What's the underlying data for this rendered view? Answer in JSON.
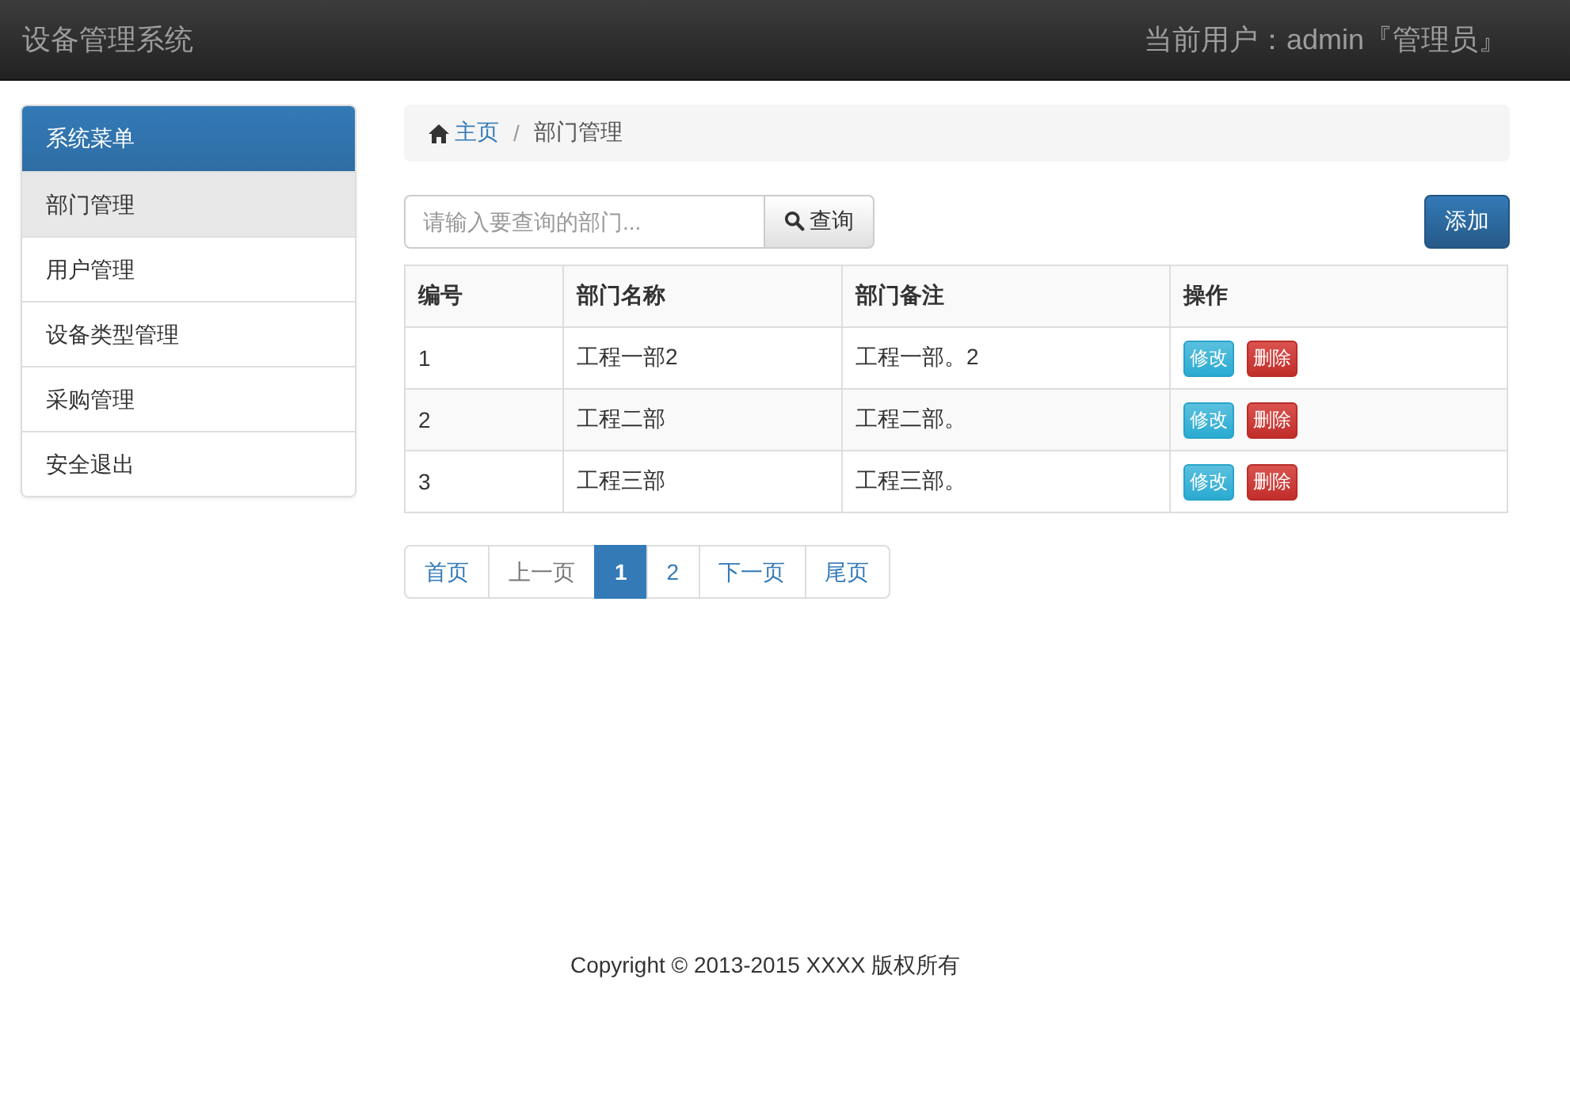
{
  "navbar": {
    "brand": "设备管理系统",
    "user_info": "当前用户：admin『管理员』"
  },
  "sidebar": {
    "title": "系统菜单",
    "items": [
      {
        "label": "部门管理",
        "selected": true
      },
      {
        "label": "用户管理",
        "selected": false
      },
      {
        "label": "设备类型管理",
        "selected": false
      },
      {
        "label": "采购管理",
        "selected": false
      },
      {
        "label": "安全退出",
        "selected": false
      }
    ]
  },
  "breadcrumb": [
    {
      "label": "主页",
      "kind": "home"
    },
    {
      "label": "/",
      "kind": "separator"
    },
    {
      "label": "部门管理",
      "kind": "current"
    }
  ],
  "search": {
    "placeholder": "请输入要查询的部门...",
    "button": "查询"
  },
  "add_button": "添加",
  "table": {
    "columns": [
      "编号",
      "部门名称",
      "部门备注",
      "操作"
    ],
    "rows": [
      {
        "cells": [
          "1",
          "工程一部2",
          "工程一部。2"
        ],
        "actions": [
          "修改",
          "删除"
        ]
      },
      {
        "cells": [
          "2",
          "工程二部",
          "工程二部。"
        ],
        "actions": [
          "修改",
          "删除"
        ]
      },
      {
        "cells": [
          "3",
          "工程三部",
          "工程三部。"
        ],
        "actions": [
          "修改",
          "删除"
        ]
      }
    ]
  },
  "pagination": [
    {
      "label": "首页",
      "selected": false,
      "disabled": false
    },
    {
      "label": "上一页",
      "selected": false,
      "disabled": true
    },
    {
      "label": "1",
      "selected": true,
      "disabled": false
    },
    {
      "label": "2",
      "selected": false,
      "disabled": false
    },
    {
      "label": "下一页",
      "selected": false,
      "disabled": false
    },
    {
      "label": "尾页",
      "selected": false,
      "disabled": false
    }
  ],
  "footer": "Copyright © 2013-2015 XXXX 版权所有"
}
